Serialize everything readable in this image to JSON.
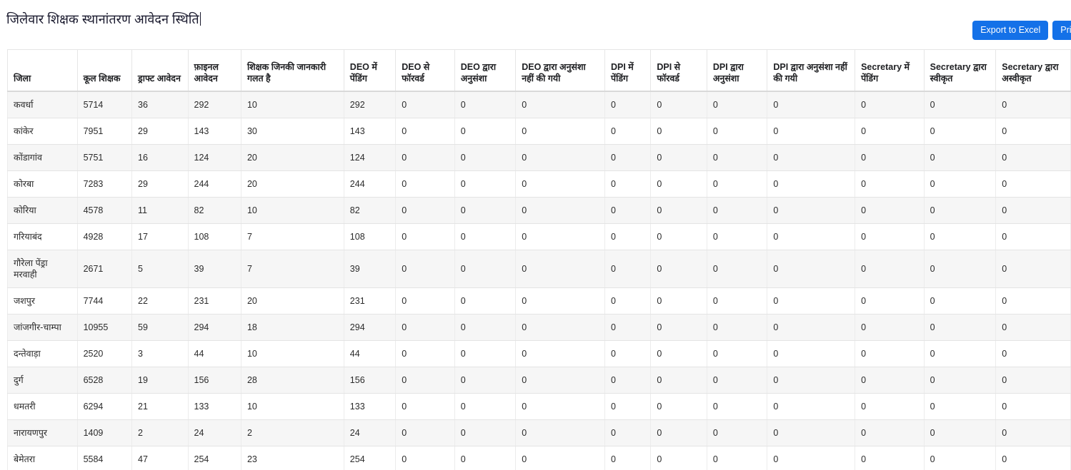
{
  "page": {
    "title": "जिलेवार शिक्षक स्थानांतरण आवेदन स्थिति",
    "accent_color": "#1471e8",
    "row_stripe_color": "#f6f6f6",
    "border_color": "#e4e4e4"
  },
  "toolbar": {
    "export_label": "Export to Excel",
    "print_label": "Print"
  },
  "table": {
    "columns": [
      "जिला",
      "कूल शिक्षक",
      "ड्राफ्ट आवेदन",
      "फ़ाइनल आवेदन",
      "शिक्षक जिनकी जानकारी गलत है",
      "DEO में पेंडिंग",
      "DEO से फॉरवर्ड",
      "DEO द्वारा अनुसंशा",
      "DEO द्वारा अनुसंशा नहीं की गयी",
      "DPI में पेंडिंग",
      "DPI से फॉरवर्ड",
      "DPI द्वारा अनुसंशा",
      "DPI द्वारा अनुसंशा नहीं की गयी",
      "Secretary में पेंडिंग",
      "Secretary द्वारा स्वीकृत",
      "Secretary द्वारा अस्वीकृत"
    ],
    "rows": [
      [
        "कवर्धा",
        "5714",
        "36",
        "292",
        "10",
        "292",
        "0",
        "0",
        "0",
        "0",
        "0",
        "0",
        "0",
        "0",
        "0",
        "0"
      ],
      [
        "कांकेर",
        "7951",
        "29",
        "143",
        "30",
        "143",
        "0",
        "0",
        "0",
        "0",
        "0",
        "0",
        "0",
        "0",
        "0",
        "0"
      ],
      [
        "कोंडागांव",
        "5751",
        "16",
        "124",
        "20",
        "124",
        "0",
        "0",
        "0",
        "0",
        "0",
        "0",
        "0",
        "0",
        "0",
        "0"
      ],
      [
        "कोरबा",
        "7283",
        "29",
        "244",
        "20",
        "244",
        "0",
        "0",
        "0",
        "0",
        "0",
        "0",
        "0",
        "0",
        "0",
        "0"
      ],
      [
        "कोरिया",
        "4578",
        "11",
        "82",
        "10",
        "82",
        "0",
        "0",
        "0",
        "0",
        "0",
        "0",
        "0",
        "0",
        "0",
        "0"
      ],
      [
        "गरियाबंद",
        "4928",
        "17",
        "108",
        "7",
        "108",
        "0",
        "0",
        "0",
        "0",
        "0",
        "0",
        "0",
        "0",
        "0",
        "0"
      ],
      [
        "गौरेला पेंड्रा मरवाही",
        "2671",
        "5",
        "39",
        "7",
        "39",
        "0",
        "0",
        "0",
        "0",
        "0",
        "0",
        "0",
        "0",
        "0",
        "0"
      ],
      [
        "जशपुर",
        "7744",
        "22",
        "231",
        "20",
        "231",
        "0",
        "0",
        "0",
        "0",
        "0",
        "0",
        "0",
        "0",
        "0",
        "0"
      ],
      [
        "जांजगीर-चाम्पा",
        "10955",
        "59",
        "294",
        "18",
        "294",
        "0",
        "0",
        "0",
        "0",
        "0",
        "0",
        "0",
        "0",
        "0",
        "0"
      ],
      [
        "दन्तेवाड़ा",
        "2520",
        "3",
        "44",
        "10",
        "44",
        "0",
        "0",
        "0",
        "0",
        "0",
        "0",
        "0",
        "0",
        "0",
        "0"
      ],
      [
        "दुर्ग",
        "6528",
        "19",
        "156",
        "28",
        "156",
        "0",
        "0",
        "0",
        "0",
        "0",
        "0",
        "0",
        "0",
        "0",
        "0"
      ],
      [
        "धमतरी",
        "6294",
        "21",
        "133",
        "10",
        "133",
        "0",
        "0",
        "0",
        "0",
        "0",
        "0",
        "0",
        "0",
        "0",
        "0"
      ],
      [
        "नारायणपुर",
        "1409",
        "2",
        "24",
        "2",
        "24",
        "0",
        "0",
        "0",
        "0",
        "0",
        "0",
        "0",
        "0",
        "0",
        "0"
      ],
      [
        "बेमेतरा",
        "5584",
        "47",
        "254",
        "23",
        "254",
        "0",
        "0",
        "0",
        "0",
        "0",
        "0",
        "0",
        "0",
        "0",
        "0"
      ]
    ]
  }
}
